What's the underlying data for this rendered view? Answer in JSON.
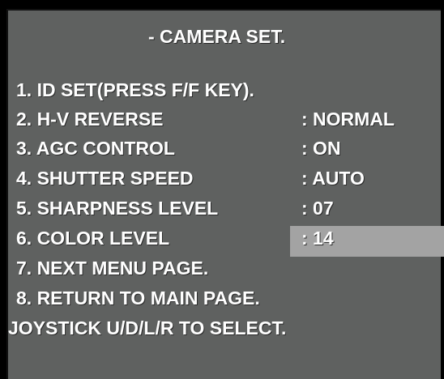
{
  "title": "- CAMERA SET.",
  "menu": {
    "items": [
      {
        "label": "1. ID SET(PRESS F/F KEY).",
        "value": ""
      },
      {
        "label": "2. H-V REVERSE",
        "value": ": NORMAL"
      },
      {
        "label": "3. AGC CONTROL",
        "value": ": ON"
      },
      {
        "label": "4. SHUTTER SPEED",
        "value": ": AUTO"
      },
      {
        "label": "5. SHARPNESS LEVEL",
        "value": ": 07"
      },
      {
        "label": "6. COLOR LEVEL",
        "value": ": 14",
        "selected": true
      },
      {
        "label": "7. NEXT MENU PAGE.",
        "value": ""
      },
      {
        "label": "8. RETURN TO MAIN PAGE.",
        "value": ""
      }
    ]
  },
  "hint": "JOYSTICK U/D/L/R TO SELECT.",
  "colors": {
    "panel": "#5f6160",
    "highlight": "#a3a3a3",
    "text": "#ffffff",
    "frame": "#000000"
  }
}
